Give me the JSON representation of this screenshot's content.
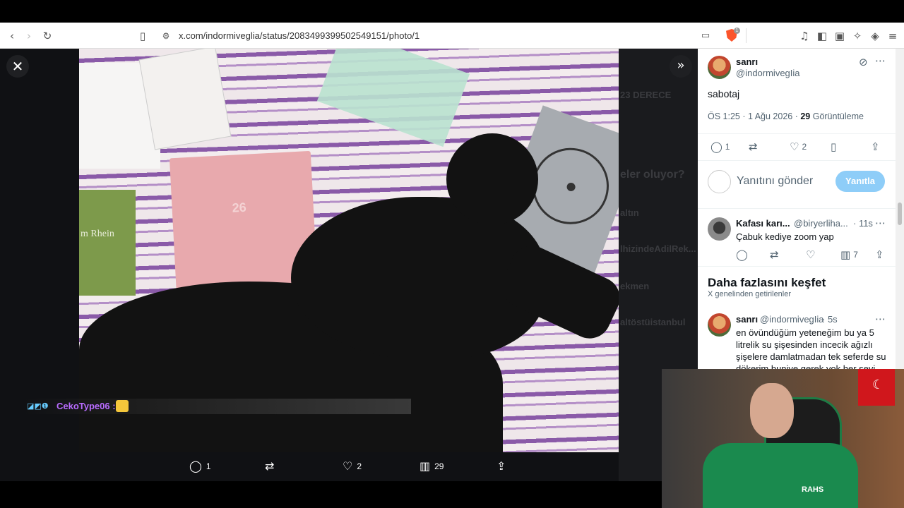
{
  "browser": {
    "url": "x.com/indormiveglia/status/2083499399502549151/photo/1",
    "brave_badge": "1",
    "icons": [
      "back-arrow-icon",
      "forward-arrow-icon",
      "reload-icon",
      "bookmark-icon",
      "site-info-icon",
      "cast-icon",
      "brave-shield-icon",
      "music-icon",
      "sidebar-icon",
      "wallet-icon",
      "leo-ai-icon",
      "vpn-icon",
      "menu-icon"
    ]
  },
  "viewer": {
    "close_label": "✕",
    "expand_label": "»",
    "actions": {
      "replies": "1",
      "reposts": "",
      "likes": "2",
      "views": "29"
    },
    "chat_overlay": {
      "username": "CekoType06",
      "separator": ":"
    },
    "bg_ghost_texts": [
      "23 DERECE",
      "eler oluyor?",
      "altın",
      "lhizindeAdilRek...",
      "ekmen",
      "altöstüistanbul"
    ]
  },
  "tweet": {
    "author_name": "sanrı",
    "author_handle": "@indormivegIia",
    "text": "sabotaj",
    "time": "ÖS 1:25 · 1 Ağu 2026 · ",
    "views_count": "29",
    "views_label": " Görüntüleme",
    "replies": "1",
    "likes": "2"
  },
  "reply_box": {
    "placeholder": "Yanıtını gönder",
    "button": "Yanıtla"
  },
  "reply": {
    "author_name": "Kafası karı...",
    "author_handle": "@biryerliha...",
    "time": "· 11s",
    "text": "Çabuk kediye zoom yap",
    "views": "7"
  },
  "explore": {
    "title": "Daha fazlasını keşfet",
    "subtitle": "X genelinden getirilenler"
  },
  "suggested": {
    "author_name": "sanrı",
    "author_handle": "@indormivegIia",
    "time": "· 5s",
    "text": "en övündüğüm yeteneğim bu ya 5 litrelik su şişesinden incecik ağızlı şişelere damlatmadan tek seferde su dökerim buniye gerek yok her şeyi"
  },
  "webcam": {
    "shirt_text": "RAHS"
  }
}
